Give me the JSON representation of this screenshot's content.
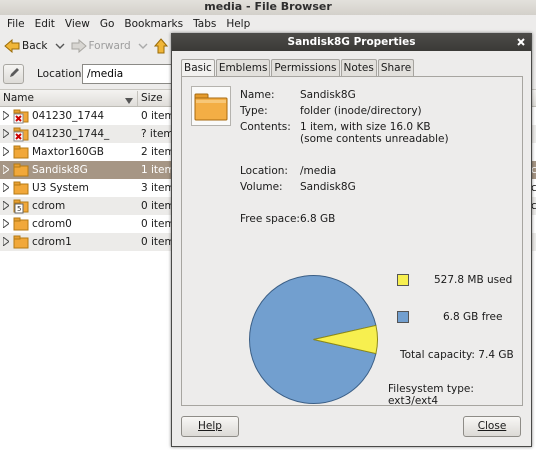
{
  "window": {
    "title": "media - File Browser"
  },
  "menubar": {
    "items": [
      "File",
      "Edit",
      "View",
      "Go",
      "Bookmarks",
      "Tabs",
      "Help"
    ]
  },
  "toolbar": {
    "back_label": "Back",
    "forward_label": "Forward"
  },
  "location": {
    "label": "Location:",
    "value": "/media"
  },
  "list": {
    "col_name": "Name",
    "col_size": "Size",
    "rows": [
      {
        "name": "041230_1744",
        "size": "0 item"
      },
      {
        "name": "041230_1744_",
        "size": "? item"
      },
      {
        "name": "Maxtor160GB",
        "size": "2 item"
      },
      {
        "name": "Sandisk8G",
        "size": "1 item"
      },
      {
        "name": "U3 System",
        "size": "3 item"
      },
      {
        "name": "cdrom",
        "size": "0 item"
      },
      {
        "name": "cdrom0",
        "size": "0 item"
      },
      {
        "name": "cdrom1",
        "size": "0 item"
      }
    ],
    "edge_chars": [
      "c",
      "c",
      "c"
    ]
  },
  "dialog": {
    "title": "Sandisk8G Properties",
    "tabs": [
      "Basic",
      "Emblems",
      "Permissions",
      "Notes",
      "Share"
    ],
    "name_label": "Name:",
    "name_value": "Sandisk8G",
    "type_label": "Type:",
    "type_value": "folder (inode/directory)",
    "contents_label": "Contents:",
    "contents_line1": "1 item, with size 16.0 KB",
    "contents_line2": "(some contents unreadable)",
    "location_label": "Location:",
    "location_value": "/media",
    "volume_label": "Volume:",
    "volume_value": "Sandisk8G",
    "free_label": "Free space:",
    "free_value": "6.8 GB",
    "used_legend": "527.8 MB used",
    "free_legend": "6.8 GB free",
    "total_capacity": "Total capacity: 7.4 GB",
    "fs_type": "Filesystem type: ext3/ext4",
    "help_button": "Help",
    "close_button": "Close"
  },
  "chart_data": {
    "type": "pie",
    "labels": [
      "used",
      "free"
    ],
    "values": [
      527.8,
      6963.2
    ],
    "units": "MB",
    "colors": [
      "#f7ef4f",
      "#729fcf"
    ]
  },
  "colors": {
    "selection": "#a69685",
    "dialog_title_bg": "#3b3a37",
    "used": "#f7ef4f",
    "free": "#729fcf"
  }
}
